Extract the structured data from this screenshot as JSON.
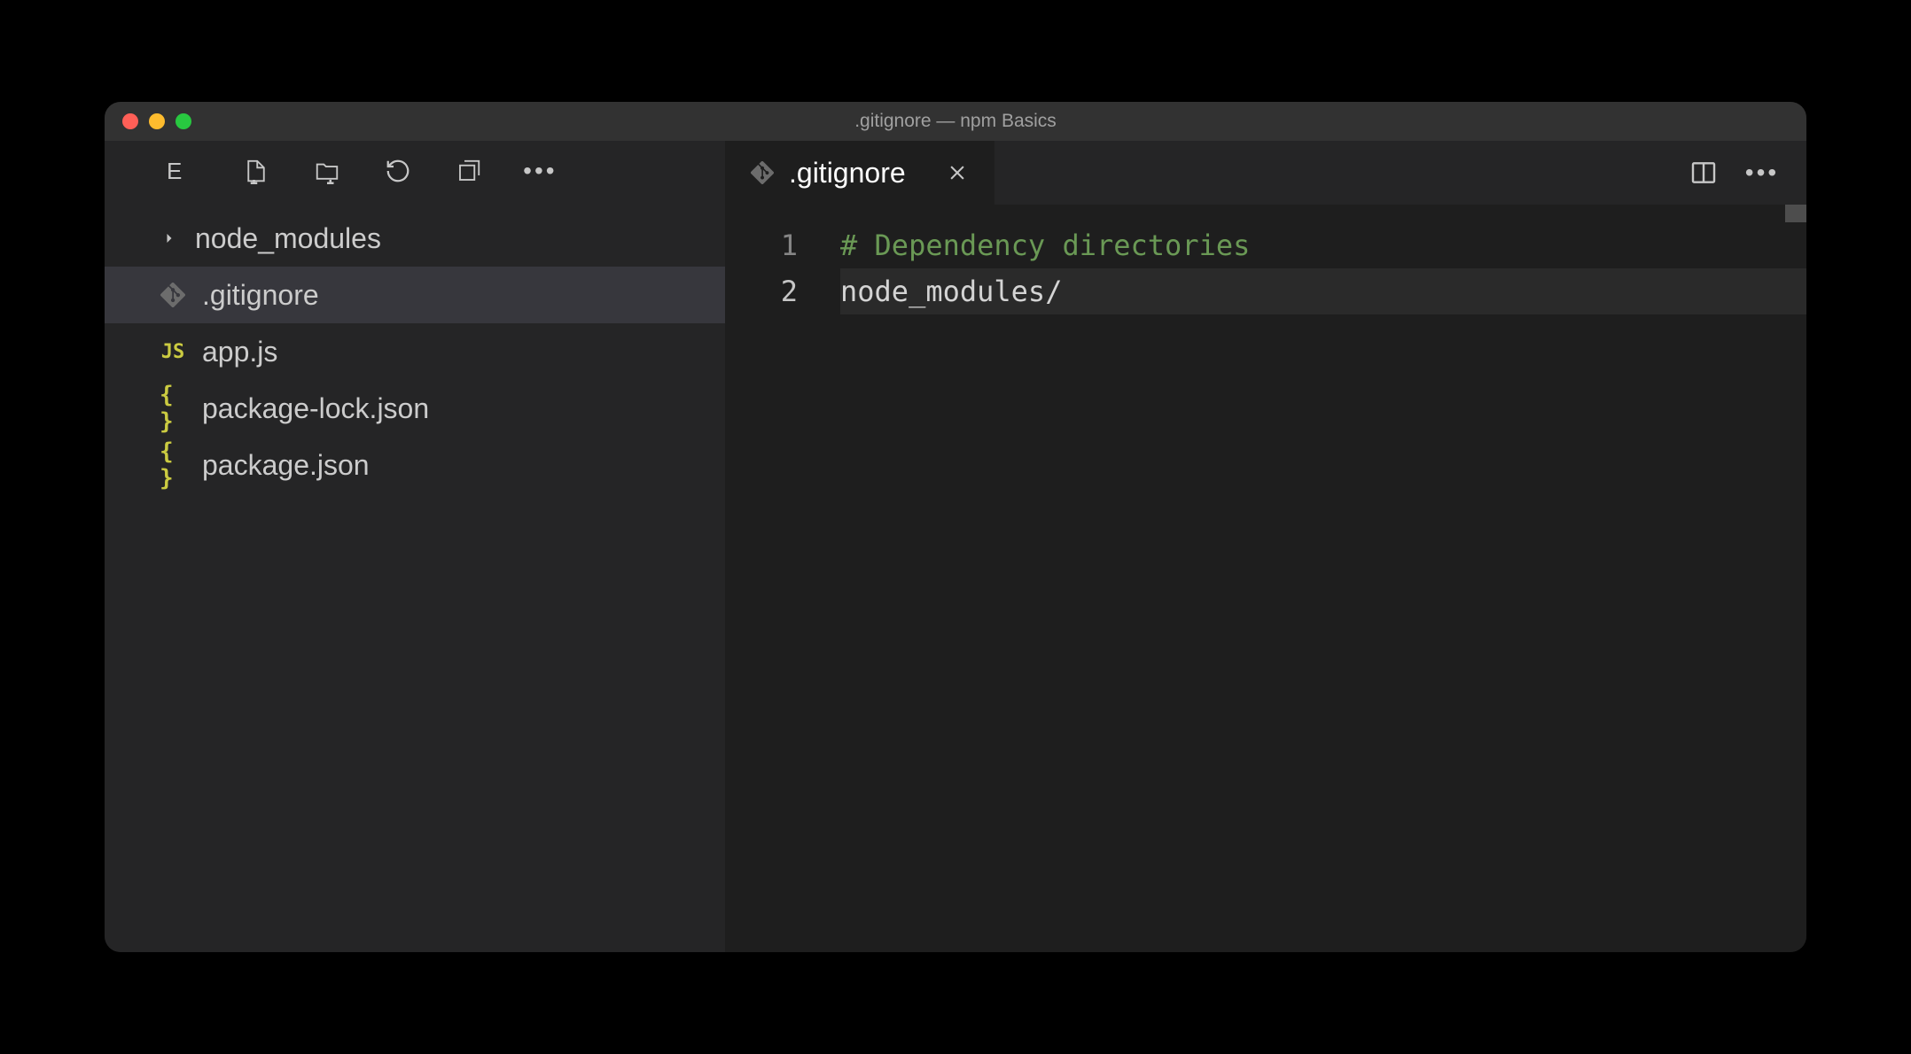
{
  "window": {
    "title": ".gitignore — npm Basics"
  },
  "sidebar": {
    "header_label": "E",
    "items": [
      {
        "name": "node_modules",
        "type": "folder",
        "icon": "chevron"
      },
      {
        "name": ".gitignore",
        "type": "file",
        "icon": "git",
        "active": true
      },
      {
        "name": "app.js",
        "type": "file",
        "icon": "js"
      },
      {
        "name": "package-lock.json",
        "type": "file",
        "icon": "json"
      },
      {
        "name": "package.json",
        "type": "file",
        "icon": "json"
      }
    ]
  },
  "tabs": {
    "active": {
      "name": ".gitignore",
      "icon": "git"
    }
  },
  "editor": {
    "lines": [
      {
        "num": "1",
        "text": "# Dependency directories",
        "class": "comment"
      },
      {
        "num": "2",
        "text": "node_modules/",
        "current": true
      }
    ]
  }
}
